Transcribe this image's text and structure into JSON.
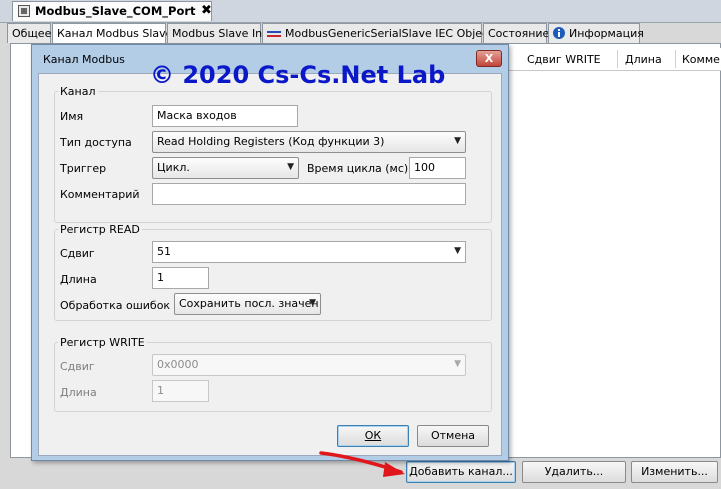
{
  "document_tab": {
    "title": "Modbus_Slave_COM_Port",
    "close": "✖"
  },
  "editor_tabs": [
    {
      "label": "Общее",
      "active": false
    },
    {
      "label": "Канал Modbus Slave",
      "active": true
    },
    {
      "label": "Modbus Slave Init",
      "active": false
    },
    {
      "label": "ModbusGenericSerialSlave IEC Objects",
      "active": false
    },
    {
      "label": "Состояние",
      "active": false
    },
    {
      "label": "Информация",
      "active": false
    }
  ],
  "table_headers": {
    "write_offset": "Сдвиг WRITE",
    "length": "Длина",
    "comment": "Комме"
  },
  "buttons": {
    "add_channel": "Добавить канал...",
    "delete": "Удалить...",
    "edit": "Изменить..."
  },
  "watermark": "© 2020 Cs-Cs.Net Lab",
  "dialog": {
    "title": "Канал Modbus",
    "close": "X",
    "channel_group": {
      "title": "Канал",
      "name_label": "Имя",
      "name_value": "Маска входов",
      "access_label": "Тип доступа",
      "access_value": "Read Holding Registers (Код функции 3)",
      "trigger_label": "Триггер",
      "trigger_value": "Цикл.",
      "cycle_time_label": "Время цикла (мс)",
      "cycle_time_value": "100",
      "comment_label": "Комментарий",
      "comment_value": ""
    },
    "read_group": {
      "title": "Регистр READ",
      "offset_label": "Сдвиг",
      "offset_value": "51",
      "length_label": "Длина",
      "length_value": "1",
      "error_label": "Обработка ошибок",
      "error_value": "Сохранить посл. значен"
    },
    "write_group": {
      "title": "Регистр WRITE",
      "offset_label": "Сдвиг",
      "offset_value": "0x0000",
      "length_label": "Длина",
      "length_value": "1"
    },
    "ok": "ОК",
    "cancel": "Отмена"
  },
  "colors": {
    "dialog_frame": "#b3cde7",
    "watermark": "#0b18c8",
    "arrow": "#e0161b"
  }
}
